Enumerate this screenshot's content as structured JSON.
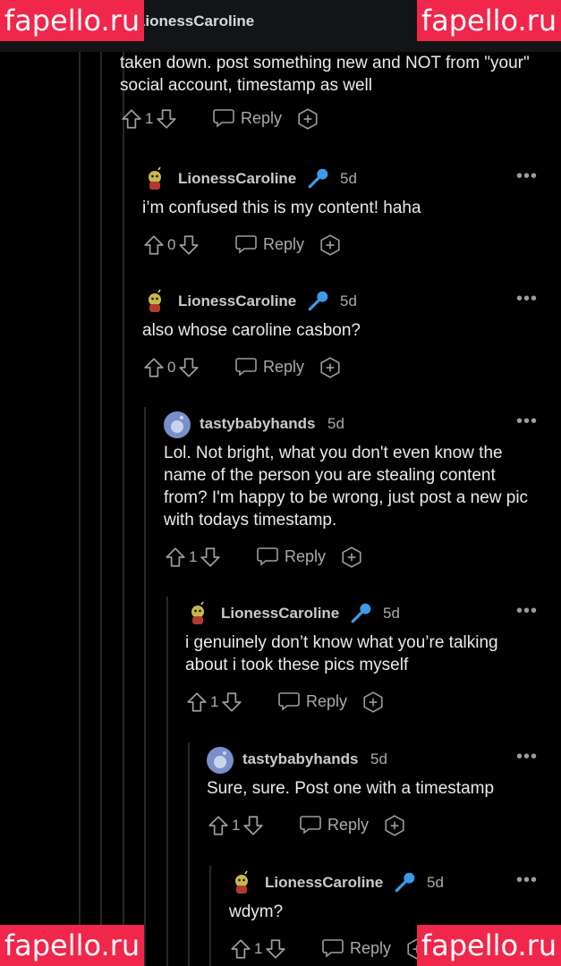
{
  "header": {
    "title": "LionessCaroline"
  },
  "watermark": {
    "text": "fapello.ru"
  },
  "parent_comment": {
    "body": "taken down. post something new and NOT from \"your\" social account, timestamp as well",
    "score": "1",
    "reply_label": "Reply"
  },
  "comments": [
    {
      "author": "LionessCaroline",
      "time": "5d",
      "body": "i’m confused this is my content! haha",
      "score": "0",
      "reply_label": "Reply"
    },
    {
      "author": "LionessCaroline",
      "time": "5d",
      "body": "also whose caroline casbon?",
      "score": "0",
      "reply_label": "Reply"
    },
    {
      "author": "tastybabyhands",
      "time": "5d",
      "body": "Lol. Not bright, what you don't even know the name of the person you are stealing content from? I'm happy to be wrong, just post a new pic with todays timestamp.",
      "score": "1",
      "reply_label": "Reply"
    },
    {
      "author": "LionessCaroline",
      "time": "5d",
      "body": "i genuinely don’t know what you’re talking about i took these pics myself",
      "score": "1",
      "reply_label": "Reply"
    },
    {
      "author": "tastybabyhands",
      "time": "5d",
      "body": "Sure, sure. Post one with a timestamp",
      "score": "1",
      "reply_label": "Reply"
    },
    {
      "author": "LionessCaroline",
      "time": "5d",
      "body": "wdym?",
      "score": "1",
      "reply_label": "Reply"
    }
  ],
  "colors": {
    "background": "#000000",
    "flair_mic": "#3b9be8",
    "watermark": "#f0264b",
    "avatar_default": "#7a8fc9"
  }
}
